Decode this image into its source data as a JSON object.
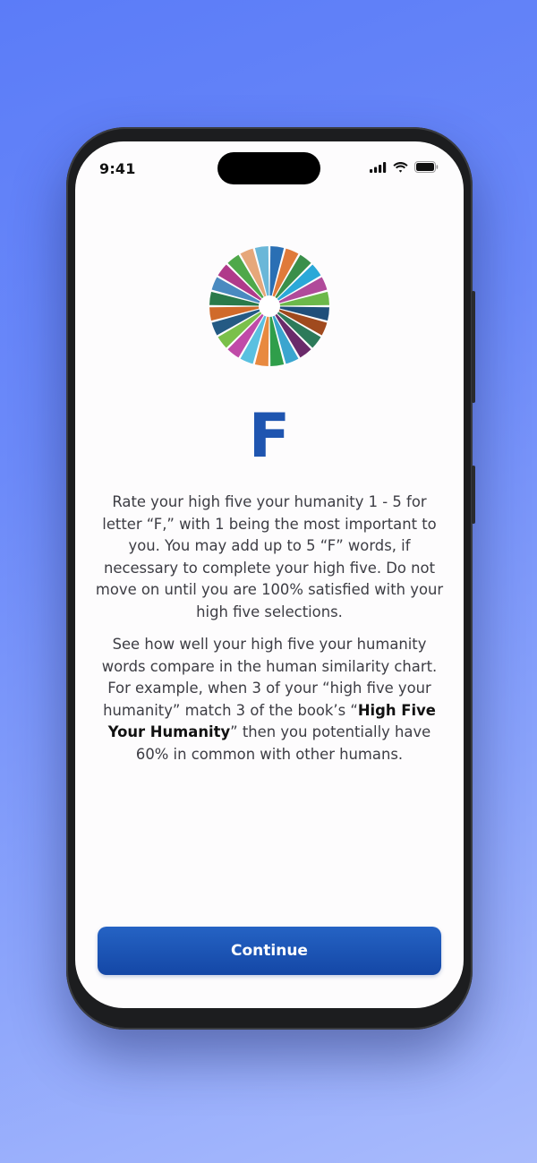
{
  "status_bar": {
    "time": "9:41"
  },
  "logo": {
    "name": "multicolor-wheel-logo",
    "colors": [
      "#2a6fb4",
      "#e07a3a",
      "#3a8f4a",
      "#2aa8d8",
      "#b04a9a",
      "#6cb84a",
      "#1f4f7a",
      "#a04a1e",
      "#2d7a5a",
      "#6a2a6a",
      "#3aa5cf",
      "#2f9e4a",
      "#e8893f",
      "#5ac0e0",
      "#c04aa8",
      "#7ac04a",
      "#245a84",
      "#d06a2a",
      "#2a7a4a",
      "#4a8ac0",
      "#b03a8a",
      "#4fa84a",
      "#e6a77a",
      "#6ab7d8"
    ]
  },
  "content": {
    "letter": "F",
    "paragraph1": "Rate your high five your humanity 1 - 5 for letter “F,” with 1 being the most important to you. You may add up to 5 “F” words, if necessary to complete your high five. Do not move on until you are 100% satisfied with your high five selections.",
    "paragraph2_part1": "See how well your high five your humanity words compare in the human similarity chart. For example, when 3 of your “high five your humanity” match 3 of the book’s “",
    "paragraph2_bold": "High Five Your Humanity",
    "paragraph2_part2": "” then you potentially have 60% in common with other humans."
  },
  "continue_button": {
    "label": "Continue"
  }
}
